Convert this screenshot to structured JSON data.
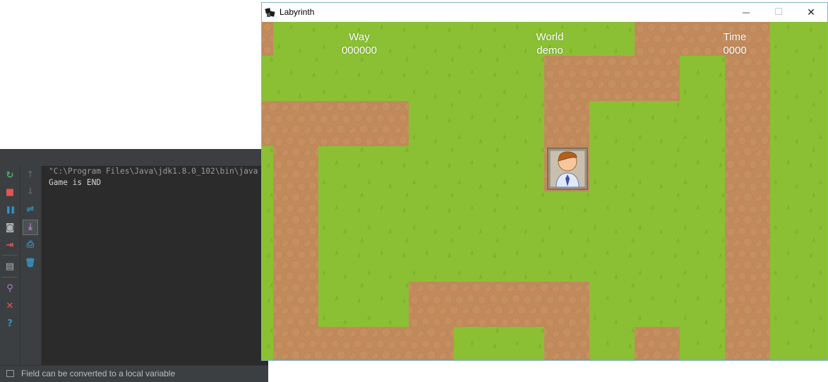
{
  "ide": {
    "console_lines": [
      "\"C:\\Program Files\\Java\\jdk1.8.0_102\\bin\\java",
      "Game is END"
    ],
    "status_text": "Field can be converted to a local variable",
    "left_toolbar": [
      {
        "name": "rerun-icon",
        "glyph": "↻",
        "color": "#59a869"
      },
      {
        "name": "stop-icon",
        "glyph": "■",
        "color": "#e05555"
      },
      {
        "name": "pause-icon",
        "glyph": "❚❚",
        "color": "#3592c4"
      },
      {
        "name": "camera-icon",
        "glyph": "◙",
        "color": "#afb1b3"
      },
      {
        "name": "exit-icon",
        "glyph": "⇥",
        "color": "#e05555"
      },
      {
        "name": "layout-icon",
        "glyph": "▤",
        "color": "#afb1b3"
      },
      {
        "name": "pin-icon",
        "glyph": "⚲",
        "color": "#b07cc6"
      },
      {
        "name": "close-icon",
        "glyph": "✕",
        "color": "#e05555"
      },
      {
        "name": "help-icon",
        "glyph": "?",
        "color": "#3592c4"
      }
    ],
    "second_toolbar": [
      {
        "name": "arrow-up-icon",
        "glyph": "↑",
        "color": "#5e6060"
      },
      {
        "name": "arrow-down-icon",
        "glyph": "↓",
        "color": "#5e6060"
      },
      {
        "name": "soft-wrap-icon",
        "glyph": "⇌",
        "color": "#3592c4"
      },
      {
        "name": "scroll-to-end-icon",
        "glyph": "⤓",
        "color": "#b07cc6"
      },
      {
        "name": "print-icon",
        "glyph": "⎙",
        "color": "#3592c4"
      },
      {
        "name": "trash-icon",
        "glyph": "🗑",
        "color": "#3592c4"
      }
    ]
  },
  "game_window": {
    "title": "Labyrinth",
    "controls": {
      "minimize": "—",
      "maximize": "☐",
      "close": "✕"
    },
    "hud": {
      "way_label": "Way",
      "way_value": "000000",
      "world_label": "World",
      "world_value": "demo",
      "time_label": "Time",
      "time_value": "0000"
    },
    "colors": {
      "grass": "#8bc034",
      "dirt": "#c18a5b"
    }
  }
}
